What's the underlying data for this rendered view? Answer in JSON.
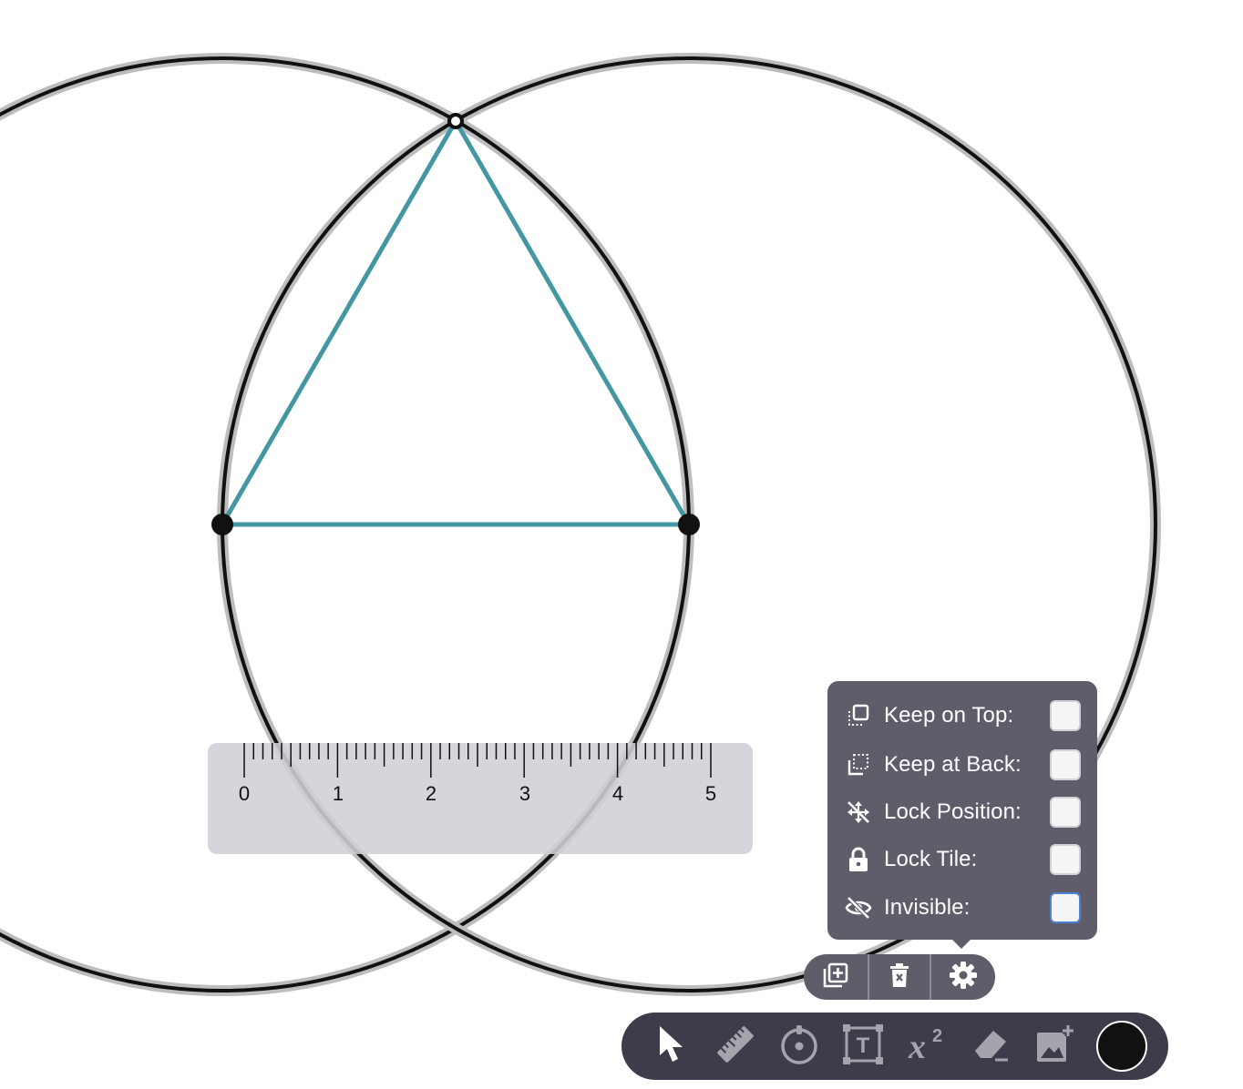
{
  "ruler": {
    "labels": [
      "0",
      "1",
      "2",
      "3",
      "4",
      "5"
    ]
  },
  "settings_panel": {
    "items": [
      {
        "label": "Keep on Top:",
        "icon": "keep-on-top-icon"
      },
      {
        "label": "Keep at Back:",
        "icon": "keep-at-back-icon"
      },
      {
        "label": "Lock Position:",
        "icon": "lock-position-icon"
      },
      {
        "label": "Lock Tile:",
        "icon": "lock-icon"
      },
      {
        "label": "Invisible:",
        "icon": "eye-off-icon"
      }
    ]
  },
  "actions": [
    "duplicate-icon",
    "delete-icon",
    "gear-icon"
  ],
  "toolbar": {
    "tools": [
      "pointer-icon",
      "ruler-icon",
      "compass-icon",
      "text-box-icon",
      "math-icon",
      "eraser-icon",
      "add-image-icon"
    ],
    "math_label": "x",
    "math_exponent": "2",
    "text_tool_letter": "T",
    "current_color": "#111111"
  },
  "colors": {
    "triangle": "#4497a0",
    "panel": "#5f5d6a",
    "toolbar": "#3e3b4a",
    "ruler": "#d3d3da"
  }
}
